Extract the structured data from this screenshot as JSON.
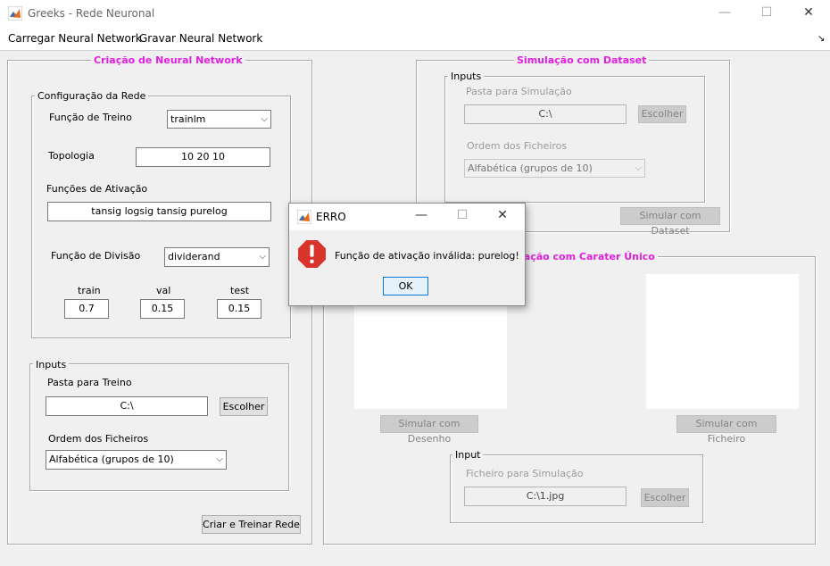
{
  "window": {
    "title": "Greeks - Rede Neuronal",
    "minimize": "—",
    "maximize": "☐",
    "close": "✕"
  },
  "menu": {
    "load": "Carregar Neural Network",
    "save": "Gravar Neural Network",
    "corner": "↘"
  },
  "left": {
    "title": "Criação de Neural Network",
    "config": {
      "title": "Configuração da Rede",
      "train_fn_label": "Função de Treino",
      "train_fn_value": "trainlm",
      "topology_label": "Topologia",
      "topology_value": "10 20 10",
      "activation_label": "Funções de Ativação",
      "activation_value": "tansig logsig tansig purelog",
      "division_label": "Função de Divisão",
      "division_value": "dividerand",
      "train_label": "train",
      "train_value": "0.7",
      "val_label": "val",
      "val_value": "0.15",
      "test_label": "test",
      "test_value": "0.15"
    },
    "inputs": {
      "title": "Inputs",
      "folder_label": "Pasta para Treino",
      "folder_value": "C:\\",
      "browse": "Escolher",
      "order_label": "Ordem dos Ficheiros",
      "order_value": "Alfabética (grupos de 10)"
    },
    "create_train": "Criar e Treinar Rede"
  },
  "dataset": {
    "title": "Simulação com Dataset",
    "inputs_title": "Inputs",
    "folder_label": "Pasta para Simulação",
    "folder_value": "C:\\",
    "browse": "Escolher",
    "order_label": "Ordem dos Ficheiros",
    "order_value": "Alfabética (grupos de 10)",
    "simulate": "Simular com Dataset"
  },
  "single": {
    "title_visible": "lação com Carater Único",
    "simulate_drawing": "Simular com Desenho",
    "simulate_file": "Simular com Ficheiro",
    "input_title": "Input",
    "file_label": "Ficheiro para Simulação",
    "file_value": "C:\\1.jpg",
    "browse": "Escolher"
  },
  "dialog": {
    "title": "ERRO",
    "message": "Função de ativação inválida: purelog!",
    "ok": "OK",
    "minimize": "—",
    "maximize": "☐",
    "close": "✕"
  },
  "colors": {
    "accent_title": "#e020e0",
    "error_icon": "#d9342b",
    "ok_border": "#0078d7"
  },
  "icons": [
    "matlab-app-icon",
    "minimize-icon",
    "maximize-icon",
    "close-icon",
    "chevron-down-icon",
    "error-icon",
    "resize-corner-icon"
  ]
}
